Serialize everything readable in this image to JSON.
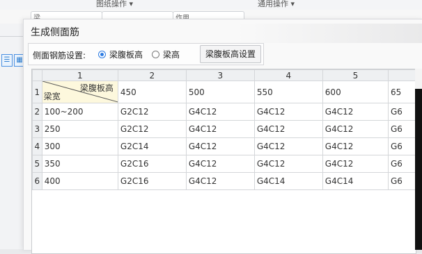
{
  "background": {
    "menu_left": "图纸操作 ▾",
    "menu_right": "通用操作 ▾",
    "tab1": "梁",
    "tab3": "作用"
  },
  "dialog": {
    "title": "生成侧面筋",
    "settings_label": "侧面钢筋设置:",
    "radio_web_height": "梁腹板高",
    "radio_beam_height": "梁高",
    "web_height_button": "梁腹板高设置",
    "selected_option": "梁腹板高"
  },
  "grid": {
    "column_headers": [
      "1",
      "2",
      "3",
      "4",
      "5",
      ""
    ],
    "corner_top": "梁腹板高",
    "corner_bottom": "梁宽",
    "header_values": [
      "450",
      "500",
      "550",
      "600",
      "65"
    ],
    "rows": [
      {
        "num": "2",
        "width": "100~200",
        "cells": [
          "G2C12",
          "G4C12",
          "G4C12",
          "G4C12",
          "G6"
        ]
      },
      {
        "num": "3",
        "width": "250",
        "cells": [
          "G2C12",
          "G4C12",
          "G4C12",
          "G4C12",
          "G6"
        ]
      },
      {
        "num": "4",
        "width": "300",
        "cells": [
          "G2C14",
          "G4C12",
          "G4C12",
          "G4C12",
          "G6"
        ]
      },
      {
        "num": "5",
        "width": "350",
        "cells": [
          "G2C16",
          "G4C12",
          "G4C12",
          "G4C12",
          "G6"
        ]
      },
      {
        "num": "6",
        "width": "400",
        "cells": [
          "G2C16",
          "G4C12",
          "G4C14",
          "G4C14",
          "G6"
        ]
      }
    ],
    "first_row_num": "1"
  },
  "colors": {
    "accent": "#2a7ae2",
    "corner_cell": "#fdf8dd",
    "header_bg": "#eef0f2"
  }
}
